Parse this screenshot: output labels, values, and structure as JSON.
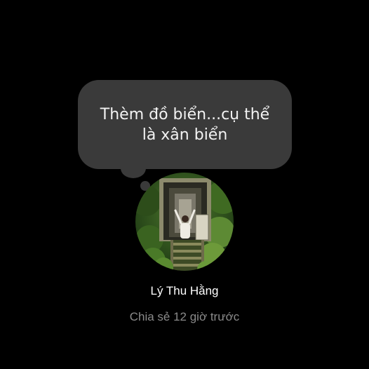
{
  "note": {
    "text": "Thèm đồ biển...cụ thể là xân biển"
  },
  "profile": {
    "name": "Lý Thu Hằng",
    "shared": "Chia sẻ 12 giờ trước"
  },
  "colors": {
    "background": "#000000",
    "bubble": "#3a3a3a",
    "name_text": "#ffffff",
    "meta_text": "#8a8a8a"
  },
  "avatar": {
    "icon": "profile-photo"
  }
}
